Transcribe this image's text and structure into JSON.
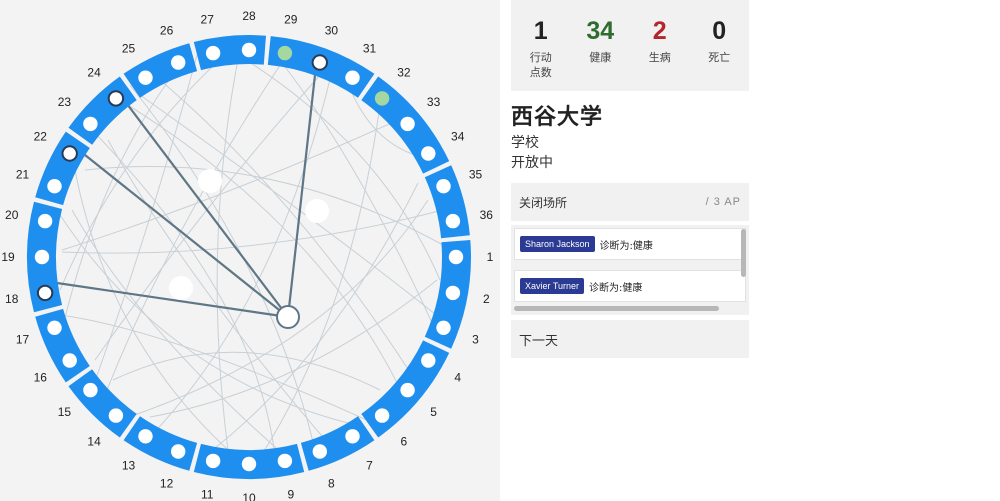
{
  "board": {
    "slot_numbers": [
      "1",
      "2",
      "3",
      "4",
      "5",
      "6",
      "7",
      "8",
      "9",
      "10",
      "11",
      "12",
      "13",
      "14",
      "15",
      "16",
      "17",
      "18",
      "19",
      "20",
      "21",
      "22",
      "23",
      "24",
      "25",
      "26",
      "27",
      "28",
      "29",
      "30",
      "31",
      "32",
      "33",
      "34",
      "35",
      "36"
    ],
    "colors": {
      "ring": "#1e8fef",
      "slot_empty": "#ffffff",
      "slot_infected": "#a4d8a0",
      "slot_selected_ring": "#2a3a55",
      "connection": "#c8d0d6",
      "active_link": "#5e7685",
      "hub_fill": "#ffffff",
      "hub_stroke": "#5e7685",
      "background": "#f3f3f3"
    }
  },
  "stats": {
    "action_points": {
      "value": "1",
      "label_line1": "行动",
      "label_line2": "点数"
    },
    "healthy": {
      "value": "34",
      "label": "健康",
      "color": "#2e6d2e"
    },
    "sick": {
      "value": "2",
      "label": "生病",
      "color": "#b3262b"
    },
    "dead": {
      "value": "0",
      "label": "死亡"
    }
  },
  "location": {
    "name": "西谷大学",
    "type": "学校",
    "status": "开放中"
  },
  "action": {
    "label": "关闭场所",
    "cost": "/ 3 AP"
  },
  "people": [
    {
      "name": "Sharon Jackson",
      "diagnosis_label": "诊断为:",
      "diagnosis": "健康"
    },
    {
      "name": "Xavier Turner",
      "diagnosis_label": "诊断为:",
      "diagnosis": "健康"
    }
  ],
  "next_day": {
    "label": "下一天"
  }
}
